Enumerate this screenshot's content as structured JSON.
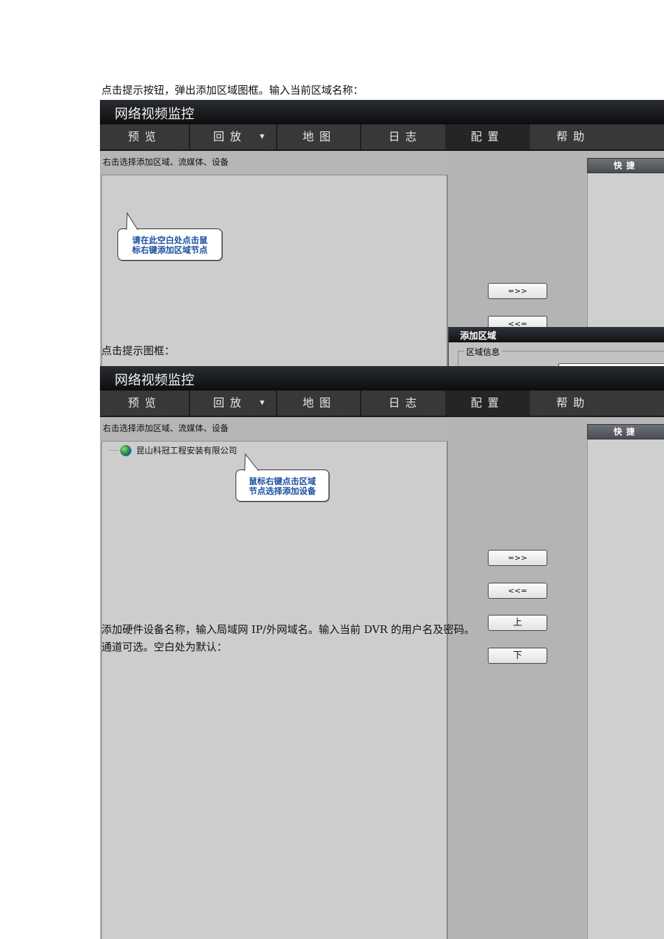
{
  "doc": {
    "line1": "点击提示按钮，弹出添加区域图框。输入当前区域名称：",
    "line2": "点击提示图框：",
    "line3": "添加硬件设备名称，输入局域网 IP/外网域名。输入当前 DVR 的用户名及密码。",
    "line4": "通道可选。空白处为默认："
  },
  "app": {
    "title": "网络视频监控",
    "nav": [
      "预览",
      "回放",
      "地图",
      "日志",
      "配置",
      "帮助"
    ],
    "nav_dropdown": "▾",
    "hint": "右击选择添加区域、流媒体、设备",
    "quick": "快捷",
    "buttons": {
      "add": "=>>",
      "remove": "<<=",
      "up": "上",
      "down": "下"
    }
  },
  "shot1": {
    "tip_line1": "请在此空白处点击鼠",
    "tip_line2": "标右键添加区域节点",
    "dialog_title": "添加区域",
    "fieldset": "区域信息"
  },
  "shot2": {
    "tree_node": "昆山科冠工程安装有限公司",
    "tip_line1": "鼠标右键点击区域",
    "tip_line2": "节点选择添加设备"
  }
}
